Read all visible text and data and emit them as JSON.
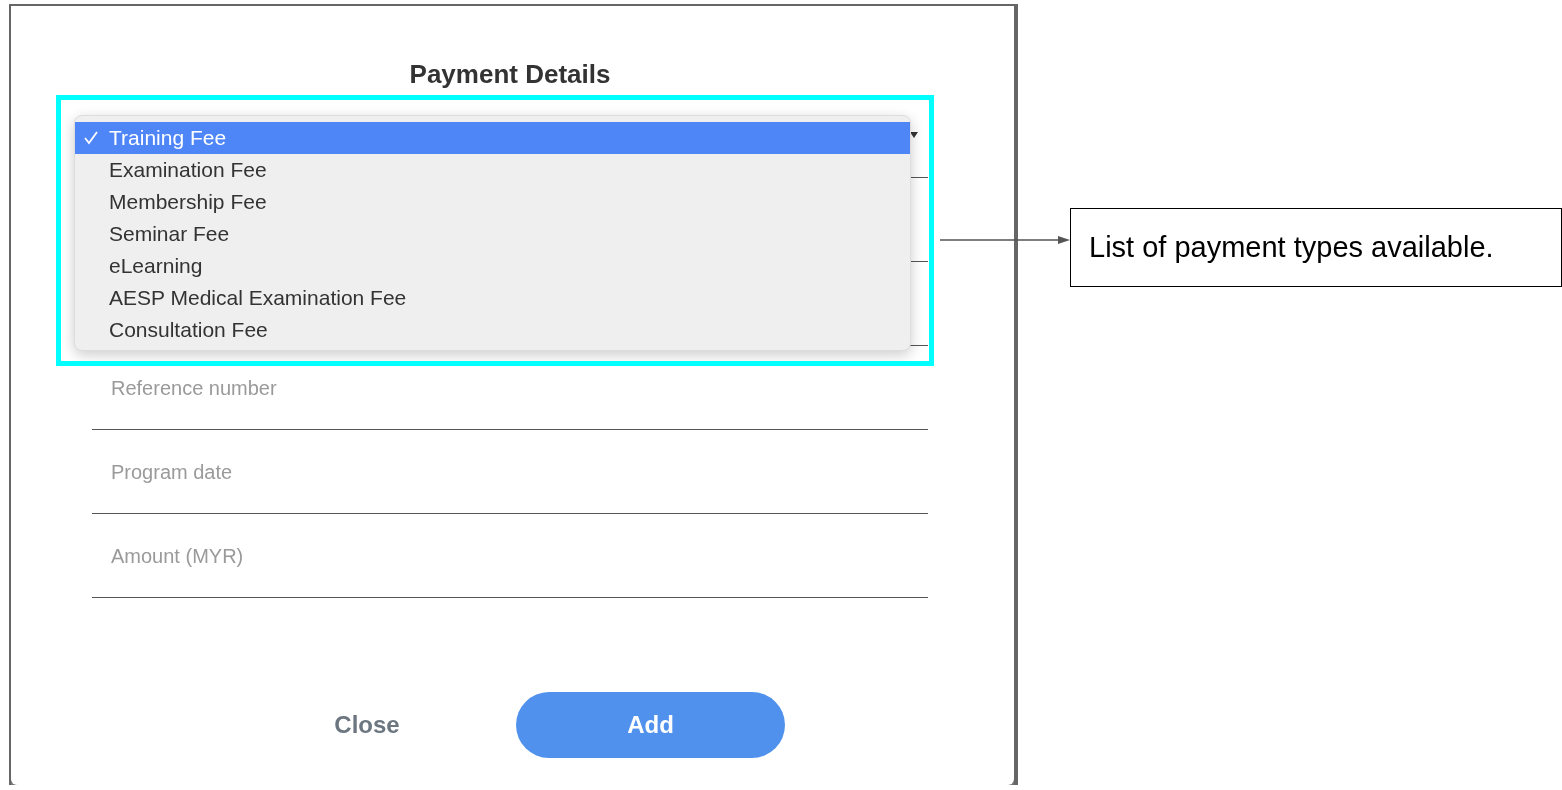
{
  "dialog": {
    "title": "Payment Details",
    "dropdown": {
      "expanded": true,
      "options": [
        {
          "label": "Training Fee",
          "selected": true
        },
        {
          "label": "Examination Fee",
          "selected": false
        },
        {
          "label": "Membership Fee",
          "selected": false
        },
        {
          "label": "Seminar Fee",
          "selected": false
        },
        {
          "label": "eLearning",
          "selected": false
        },
        {
          "label": "AESP Medical Examination Fee",
          "selected": false
        },
        {
          "label": "Consultation Fee",
          "selected": false
        }
      ]
    },
    "fields": [
      {
        "placeholder": "Reference number"
      },
      {
        "placeholder": "Program date"
      },
      {
        "placeholder": "Amount (MYR)"
      }
    ],
    "buttons": [
      {
        "label": "Close",
        "kind": "text"
      },
      {
        "label": "Add",
        "kind": "primary"
      }
    ]
  },
  "annotation": {
    "text": "List of payment types available."
  }
}
